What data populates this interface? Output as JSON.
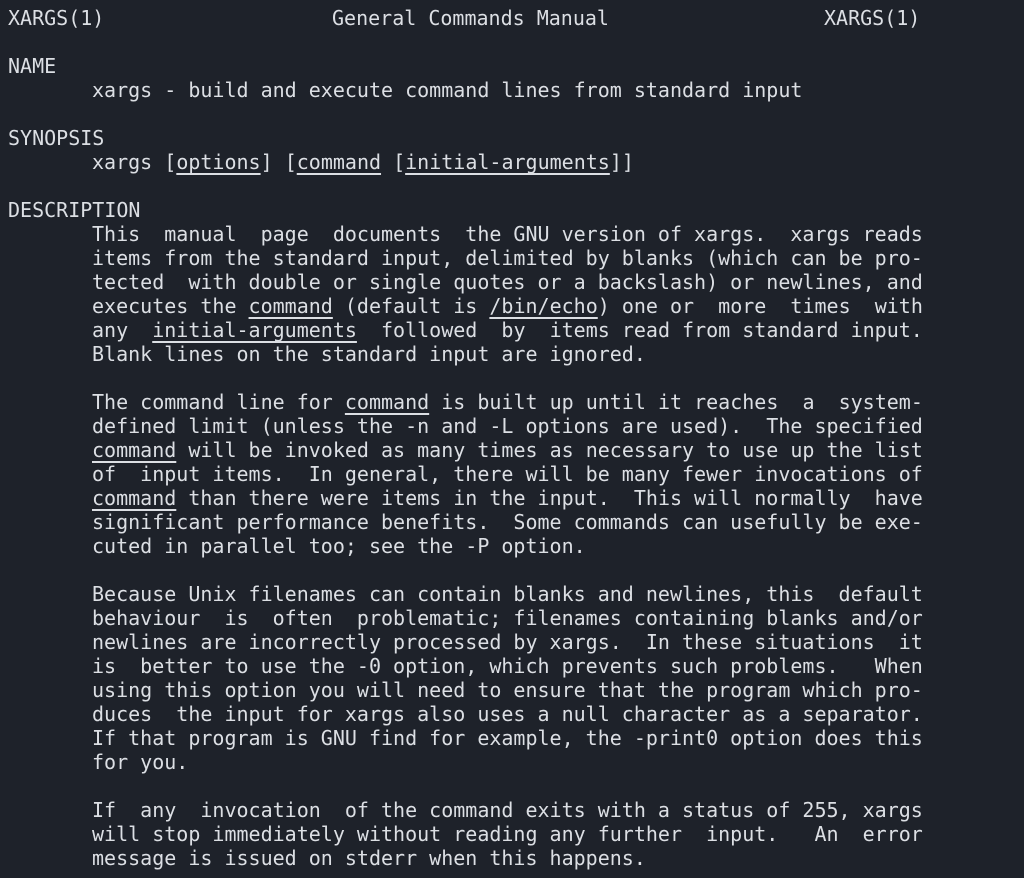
{
  "header": {
    "left": "XARGS(1)",
    "center": "General Commands Manual",
    "right": "XARGS(1)"
  },
  "sections": {
    "name": {
      "heading": "NAME",
      "text": "xargs - build and execute command lines from standard input"
    },
    "synopsis": {
      "heading": "SYNOPSIS",
      "cmd": "xargs",
      "open1": " [",
      "options": "options",
      "close1": "] [",
      "command": "command",
      "open2": " [",
      "initial_args": "initial-arguments",
      "close2": "]]"
    },
    "description": {
      "heading": "DESCRIPTION",
      "p1": {
        "l1": "This  manual  page  documents  the GNU version of xargs.  xargs reads",
        "l2": "items from the standard input, delimited by blanks (which can be pro-",
        "l3": "tected  with double or single quotes or a backslash) or newlines, and",
        "l4_a": "executes the ",
        "l4_cmd": "command",
        "l4_b": " (default is ",
        "l4_echo": "/bin/echo",
        "l4_c": ") one or  more  times  with",
        "l5_a": "any  ",
        "l5_init": "initial-arguments",
        "l5_b": "  followed  by  items read from standard input.",
        "l6": "Blank lines on the standard input are ignored."
      },
      "p2": {
        "l1_a": "The command line for ",
        "l1_cmd": "command",
        "l1_b": " is built up until it reaches  a  system-",
        "l2": "defined limit (unless the -n and -L options are used).  The specified",
        "l3_cmd": "command",
        "l3_b": " will be invoked as many times as necessary to use up the list",
        "l4": "of  input items.  In general, there will be many fewer invocations of",
        "l5_cmd": "command",
        "l5_b": " than there were items in the input.  This will normally  have",
        "l6": "significant performance benefits.  Some commands can usefully be exe-",
        "l7": "cuted in parallel too; see the -P option."
      },
      "p3": {
        "l1": "Because Unix filenames can contain blanks and newlines, this  default",
        "l2": "behaviour  is  often  problematic; filenames containing blanks and/or",
        "l3": "newlines are incorrectly processed by xargs.  In these situations  it",
        "l4": "is  better to use the -0 option, which prevents such problems.   When",
        "l5": "using this option you will need to ensure that the program which pro-",
        "l6": "duces  the input for xargs also uses a null character as a separator.",
        "l7": "If that program is GNU find for example, the -print0 option does this",
        "l8": "for you."
      },
      "p4": {
        "l1": "If  any  invocation  of the command exits with a status of 255, xargs",
        "l2": "will stop immediately without reading any further  input.   An  error",
        "l3": "message is issued on stderr when this happens."
      }
    }
  }
}
